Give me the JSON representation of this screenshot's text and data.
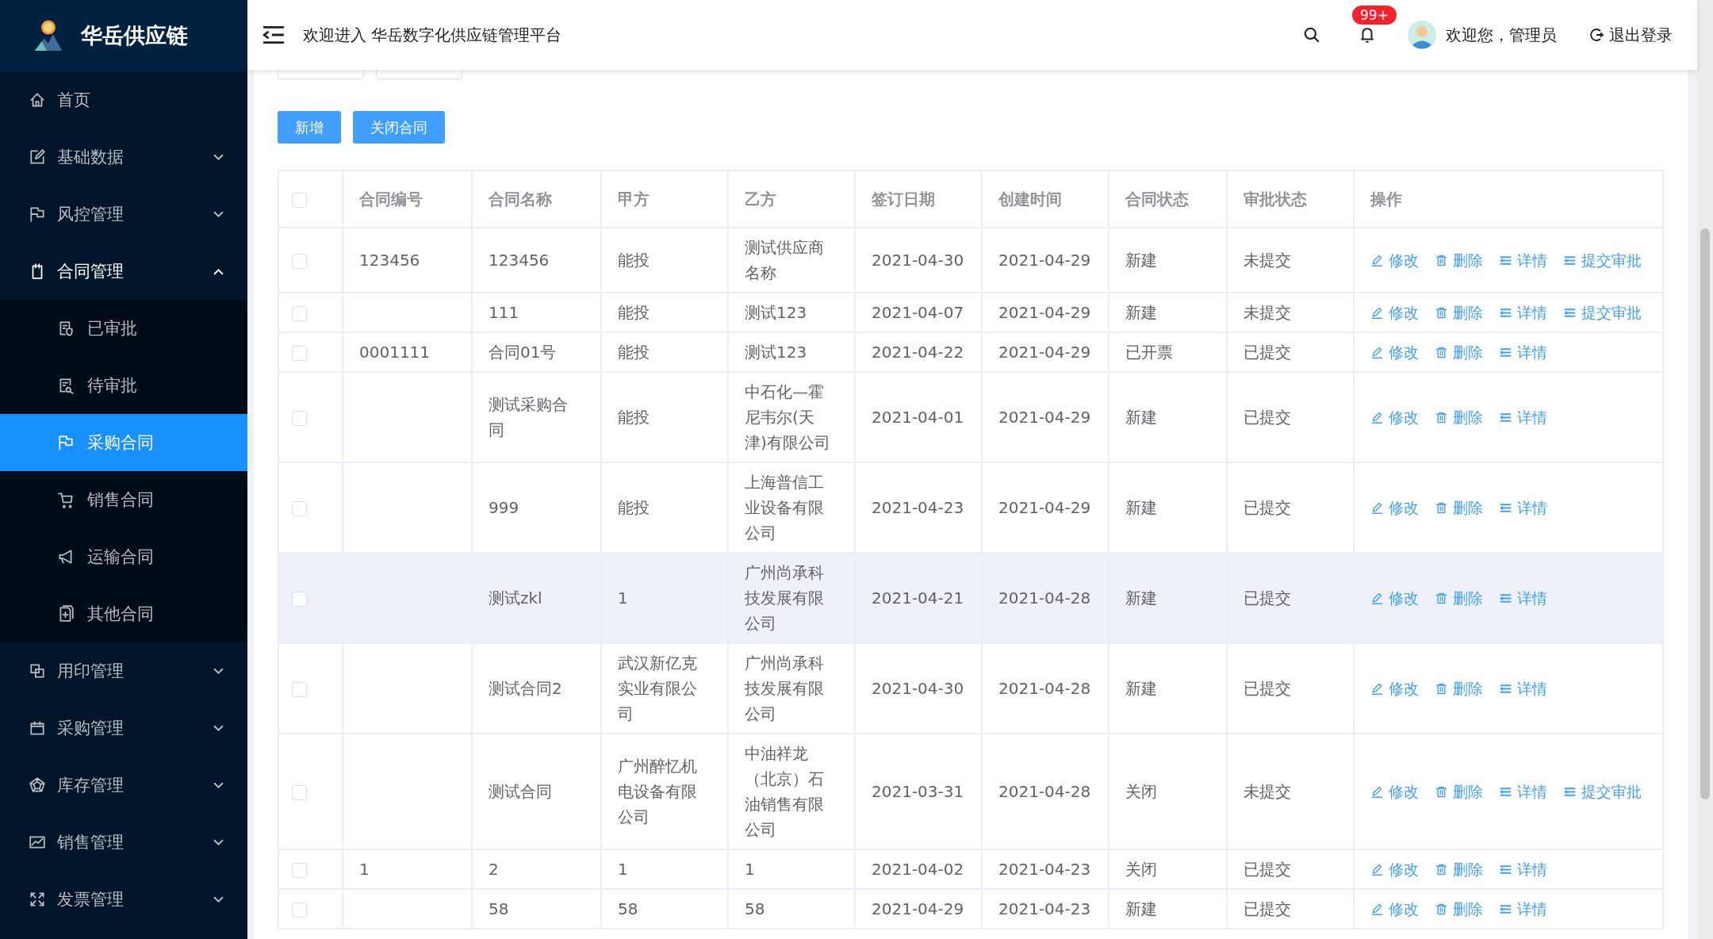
{
  "sidebar": {
    "brand": "华岳供应链",
    "items": [
      {
        "label": "首页",
        "selected": false
      },
      {
        "label": "基础数据",
        "selected": false,
        "expanded": false
      },
      {
        "label": "风控管理",
        "selected": false,
        "expanded": false
      },
      {
        "label": "合同管理",
        "selected": false,
        "expanded": true,
        "children": [
          {
            "label": "已审批",
            "selected": false
          },
          {
            "label": "待审批",
            "selected": false
          },
          {
            "label": "采购合同",
            "selected": true
          },
          {
            "label": "销售合同",
            "selected": false
          },
          {
            "label": "运输合同",
            "selected": false
          },
          {
            "label": "其他合同",
            "selected": false
          }
        ]
      },
      {
        "label": "用印管理",
        "selected": false,
        "expanded": false
      },
      {
        "label": "采购管理",
        "selected": false,
        "expanded": false
      },
      {
        "label": "库存管理",
        "selected": false,
        "expanded": false
      },
      {
        "label": "销售管理",
        "selected": false,
        "expanded": false
      },
      {
        "label": "发票管理",
        "selected": false,
        "expanded": false
      }
    ]
  },
  "header": {
    "title": "欢迎进入 华岳数字化供应链管理平台",
    "notification_badge": "99+",
    "user_greeting": "欢迎您，管理员",
    "logout": "退出登录"
  },
  "toolbar": [
    "新增",
    "关闭合同"
  ],
  "table": {
    "select_all": {
      "checked": false
    },
    "columns": [
      "合同编号",
      "合同名称",
      "甲方",
      "乙方",
      "签订日期",
      "创建时间",
      "合同状态",
      "审批状态",
      "操作"
    ],
    "rows": [
      {
        "checked": false,
        "hovered": false,
        "contract_no": "123456",
        "name": "123456",
        "party_a": "能投",
        "party_b": "测试供应商名称",
        "sign_date": "2021-04-30",
        "created": "2021-04-29",
        "status": "新建",
        "approval": "未提交",
        "actions": [
          {
            "kind": "edit",
            "label": "修改"
          },
          {
            "kind": "delete",
            "label": "删除"
          },
          {
            "kind": "detail",
            "label": "详情"
          },
          {
            "kind": "submit",
            "label": "提交审批"
          }
        ]
      },
      {
        "checked": false,
        "hovered": false,
        "name": "111",
        "party_a": "能投",
        "party_b": "测试123",
        "sign_date": "2021-04-07",
        "created": "2021-04-29",
        "status": "新建",
        "approval": "未提交",
        "actions": [
          {
            "kind": "edit",
            "label": "修改"
          },
          {
            "kind": "delete",
            "label": "删除"
          },
          {
            "kind": "detail",
            "label": "详情"
          },
          {
            "kind": "submit",
            "label": "提交审批"
          }
        ]
      },
      {
        "checked": false,
        "hovered": false,
        "contract_no": "0001111",
        "name": "合同01号",
        "party_a": "能投",
        "party_b": "测试123",
        "sign_date": "2021-04-22",
        "created": "2021-04-29",
        "status": "已开票",
        "approval": "已提交",
        "actions": [
          {
            "kind": "edit",
            "label": "修改"
          },
          {
            "kind": "delete",
            "label": "删除"
          },
          {
            "kind": "detail",
            "label": "详情"
          }
        ]
      },
      {
        "checked": false,
        "hovered": false,
        "name": "测试采购合同",
        "party_a": "能投",
        "party_b": "中石化—霍尼韦尔(天津)有限公司",
        "sign_date": "2021-04-01",
        "created": "2021-04-29",
        "status": "新建",
        "approval": "已提交",
        "actions": [
          {
            "kind": "edit",
            "label": "修改"
          },
          {
            "kind": "delete",
            "label": "删除"
          },
          {
            "kind": "detail",
            "label": "详情"
          }
        ]
      },
      {
        "checked": false,
        "hovered": false,
        "name": "999",
        "party_a": "能投",
        "party_b": "上海普信工业设备有限公司",
        "sign_date": "2021-04-23",
        "created": "2021-04-29",
        "status": "新建",
        "approval": "已提交",
        "actions": [
          {
            "kind": "edit",
            "label": "修改"
          },
          {
            "kind": "delete",
            "label": "删除"
          },
          {
            "kind": "detail",
            "label": "详情"
          }
        ]
      },
      {
        "checked": false,
        "hovered": true,
        "name": "测试zkl",
        "party_a": "1",
        "party_b": "广州尚承科技发展有限公司",
        "sign_date": "2021-04-21",
        "created": "2021-04-28",
        "status": "新建",
        "approval": "已提交",
        "actions": [
          {
            "kind": "edit",
            "label": "修改"
          },
          {
            "kind": "delete",
            "label": "删除"
          },
          {
            "kind": "detail",
            "label": "详情"
          }
        ]
      },
      {
        "checked": false,
        "hovered": false,
        "name": "测试合同2",
        "party_a": "武汉新亿克实业有限公司",
        "party_b": "广州尚承科技发展有限公司",
        "sign_date": "2021-04-30",
        "created": "2021-04-28",
        "status": "新建",
        "approval": "已提交",
        "actions": [
          {
            "kind": "edit",
            "label": "修改"
          },
          {
            "kind": "delete",
            "label": "删除"
          },
          {
            "kind": "detail",
            "label": "详情"
          }
        ]
      },
      {
        "checked": false,
        "hovered": false,
        "name": "测试合同",
        "party_a": "广州醉忆机电设备有限公司",
        "party_b": "中油祥龙（北京）石油销售有限公司",
        "sign_date": "2021-03-31",
        "created": "2021-04-28",
        "status": "关闭",
        "approval": "未提交",
        "actions": [
          {
            "kind": "edit",
            "label": "修改"
          },
          {
            "kind": "delete",
            "label": "删除"
          },
          {
            "kind": "detail",
            "label": "详情"
          },
          {
            "kind": "submit",
            "label": "提交审批"
          }
        ]
      },
      {
        "checked": false,
        "hovered": false,
        "contract_no": "1",
        "name": "2",
        "party_a": "1",
        "party_b": "1",
        "sign_date": "2021-04-02",
        "created": "2021-04-23",
        "status": "关闭",
        "approval": "已提交",
        "actions": [
          {
            "kind": "edit",
            "label": "修改"
          },
          {
            "kind": "delete",
            "label": "删除"
          },
          {
            "kind": "detail",
            "label": "详情"
          }
        ]
      },
      {
        "checked": false,
        "hovered": false,
        "name": "58",
        "party_a": "58",
        "party_b": "58",
        "sign_date": "2021-04-29",
        "created": "2021-04-23",
        "status": "新建",
        "approval": "已提交",
        "actions": [
          {
            "kind": "edit",
            "label": "修改"
          },
          {
            "kind": "delete",
            "label": "删除"
          },
          {
            "kind": "detail",
            "label": "详情"
          }
        ]
      }
    ]
  }
}
